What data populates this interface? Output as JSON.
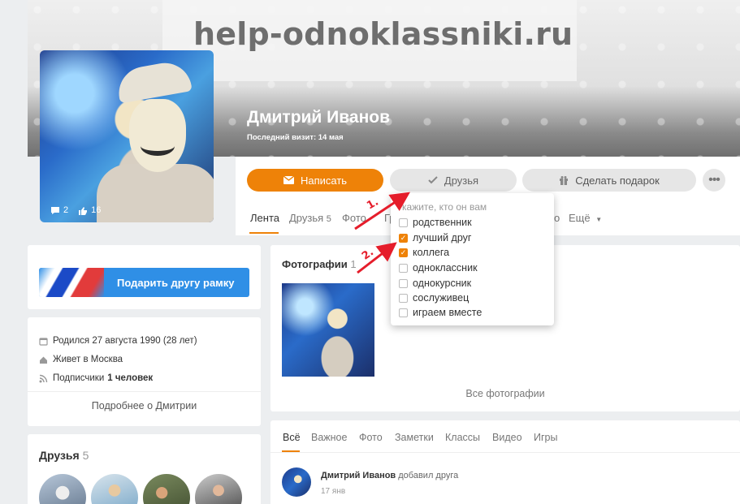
{
  "watermark": "help-odnoklassniki.ru",
  "profile": {
    "name": "Дмитрий Иванов",
    "last_visit": "Последний визит: 14 мая",
    "avatar_comments": "2",
    "avatar_likes": "16"
  },
  "actions": {
    "write": "Написать",
    "friends": "Друзья",
    "gift": "Сделать подарок",
    "more": "•••"
  },
  "tabs": [
    {
      "label": "Лента"
    },
    {
      "label": "Друзья",
      "count": "5"
    },
    {
      "label": "Фото"
    },
    {
      "label": "Гр"
    },
    {
      "label": "о"
    },
    {
      "label": "Ещё"
    }
  ],
  "relation_dropdown": {
    "title": "кажите, кто он вам",
    "options": [
      {
        "label": "родственник",
        "checked": false
      },
      {
        "label": "лучший друг",
        "checked": true
      },
      {
        "label": "коллега",
        "checked": true
      },
      {
        "label": "одноклассник",
        "checked": false
      },
      {
        "label": "однокурсник",
        "checked": false
      },
      {
        "label": "сослуживец",
        "checked": false
      },
      {
        "label": "играем вместе",
        "checked": false
      }
    ]
  },
  "annotations": [
    "1.",
    "2."
  ],
  "frame_promo": {
    "label": "Подарить другу рамку"
  },
  "info": {
    "born": "Родился 27 августа 1990 (28 лет)",
    "lives": "Живет в Москва",
    "subscribers_prefix": "Подписчики",
    "subscribers_count": "1 человек",
    "more_about": "Подробнее о Дмитрии"
  },
  "friends_block": {
    "title": "Друзья",
    "count": "5"
  },
  "photos_block": {
    "title": "Фотографии",
    "count": "1",
    "all_link": "Все фотографии"
  },
  "feed": {
    "tabs": [
      "Всё",
      "Важное",
      "Фото",
      "Заметки",
      "Классы",
      "Видео",
      "Игры"
    ],
    "item_author": "Дмитрий Иванов",
    "item_action": "добавил друга",
    "item_date": "17 янв"
  },
  "colors": {
    "accent": "#ee8208",
    "link_blue": "#2f8fe6",
    "arrow_red": "#e51d2b"
  }
}
